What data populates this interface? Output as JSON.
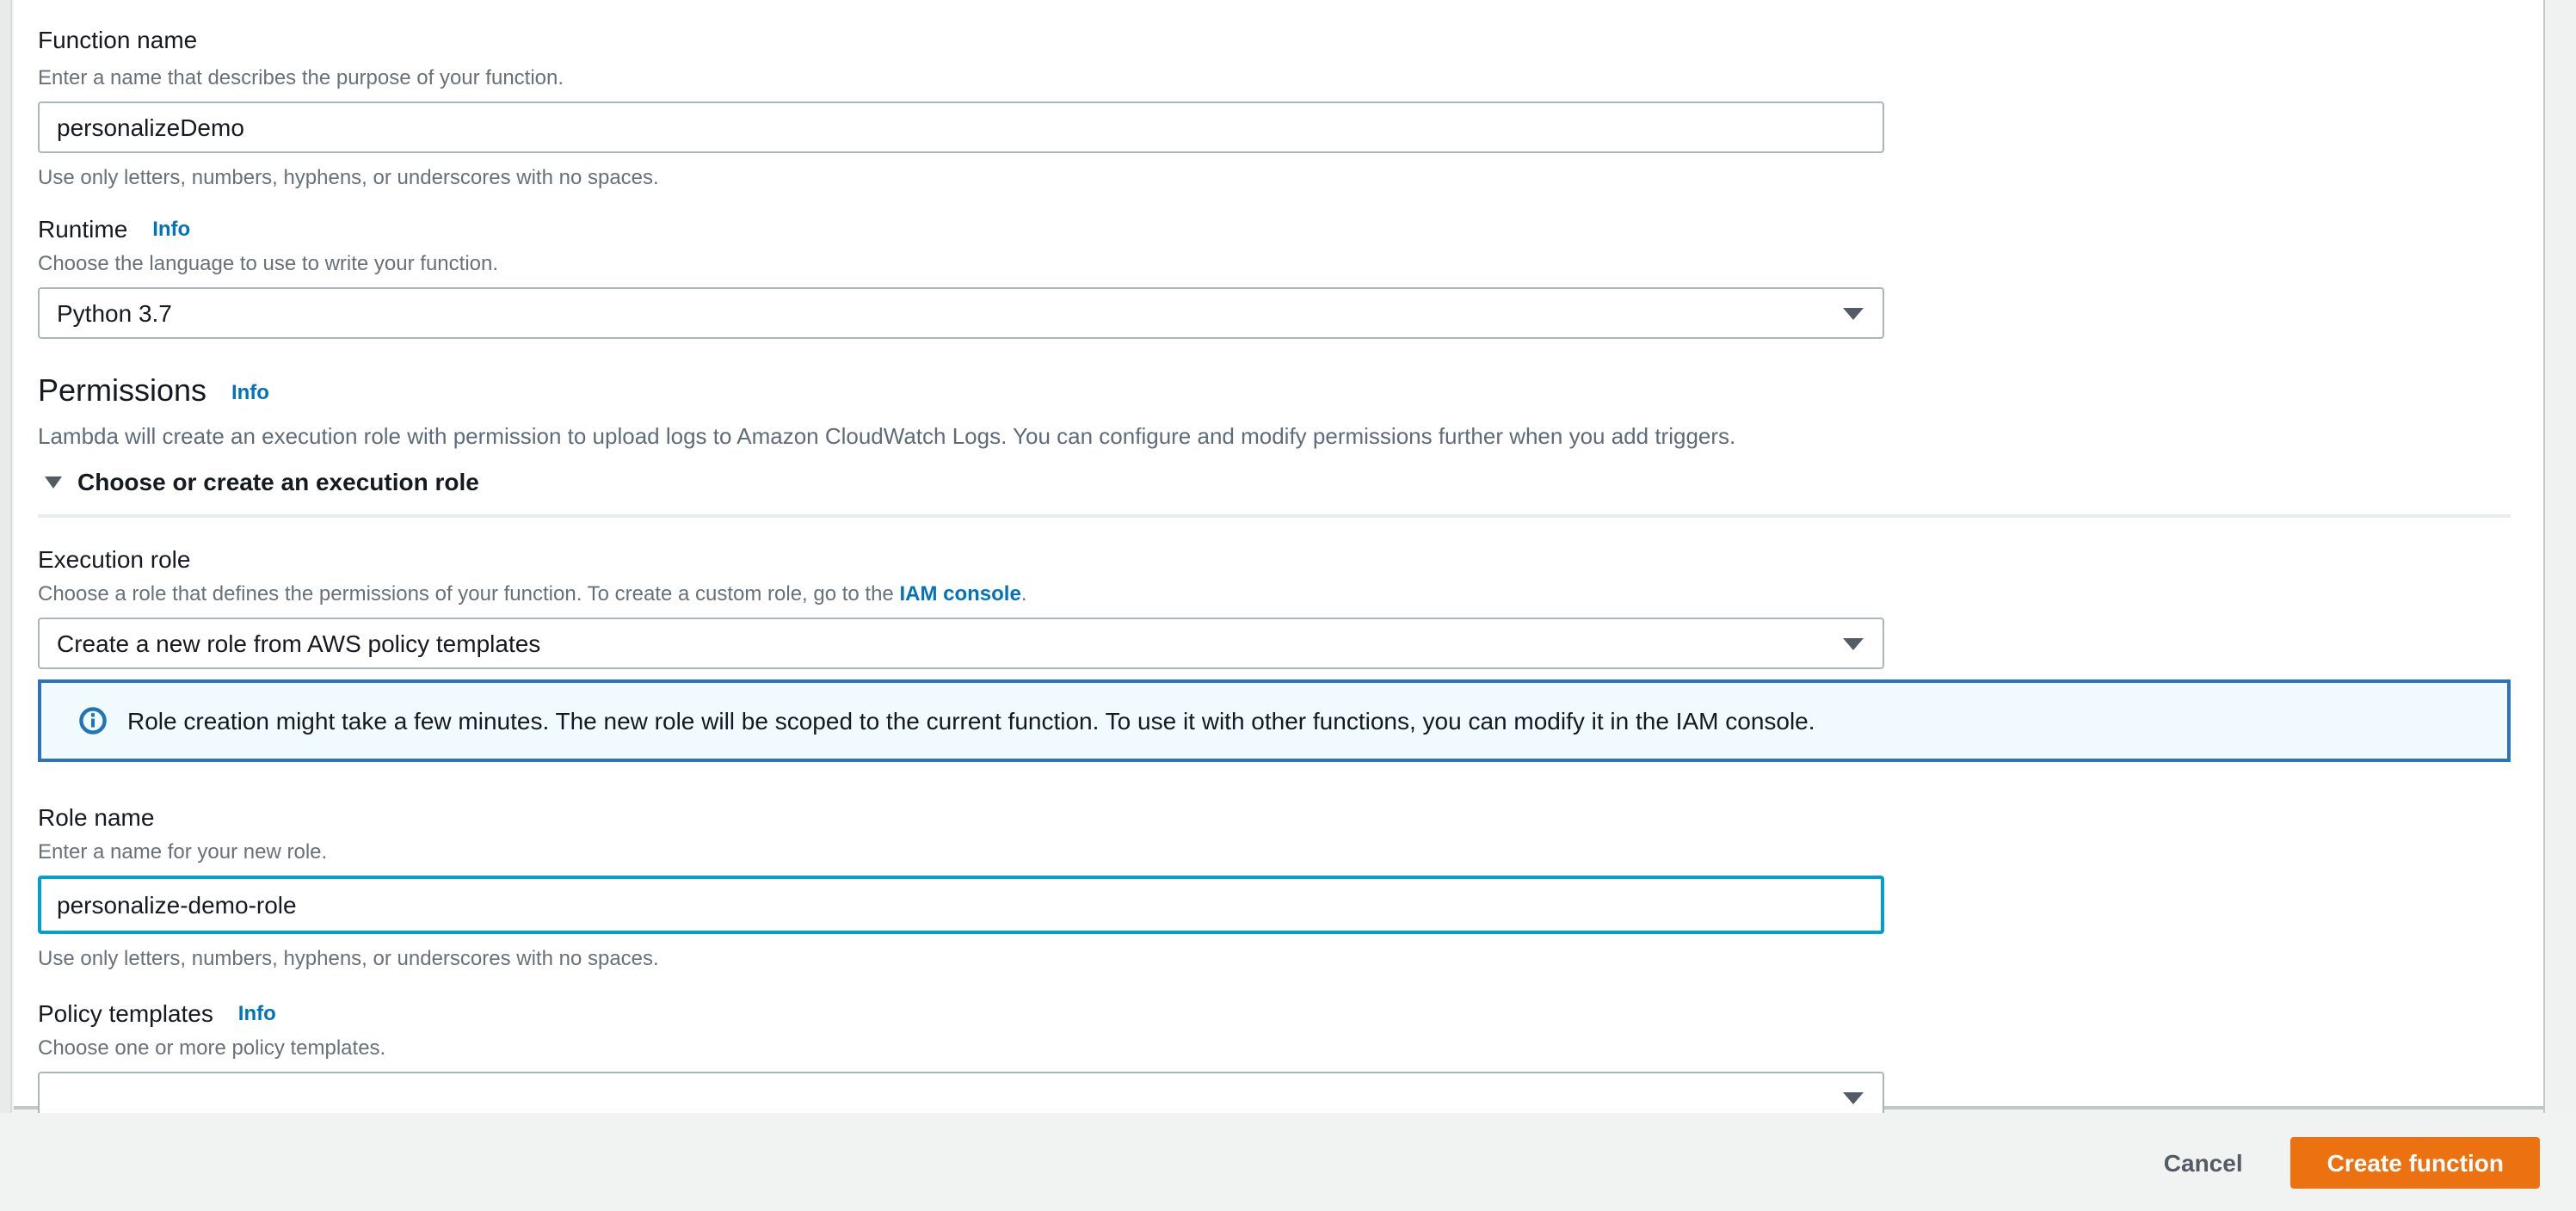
{
  "form": {
    "function_name": {
      "label": "Function name",
      "description": "Enter a name that describes the purpose of your function.",
      "value": "personalizeDemo",
      "helper": "Use only letters, numbers, hyphens, or underscores with no spaces."
    },
    "runtime": {
      "label": "Runtime",
      "info_label": "Info",
      "description": "Choose the language to use to write your function.",
      "value": "Python 3.7"
    },
    "permissions": {
      "title": "Permissions",
      "info_label": "Info",
      "description": "Lambda will create an execution role with permission to upload logs to Amazon CloudWatch Logs. You can configure and modify permissions further when you add triggers.",
      "expander_label": "Choose or create an execution role"
    },
    "execution_role": {
      "label": "Execution role",
      "description_prefix": "Choose a role that defines the permissions of your function. To create a custom role, go to the ",
      "link_label": "IAM console",
      "description_suffix": ".",
      "value": "Create a new role from AWS policy templates"
    },
    "role_alert": {
      "text": "Role creation might take a few minutes. The new role will be scoped to the current function. To use it with other functions, you can modify it in the IAM console."
    },
    "role_name": {
      "label": "Role name",
      "description": "Enter a name for your new role.",
      "value": "personalize-demo-role",
      "helper": "Use only letters, numbers, hyphens, or underscores with no spaces."
    },
    "policy_templates": {
      "label": "Policy templates",
      "info_label": "Info",
      "description": "Choose one or more policy templates.",
      "value": ""
    }
  },
  "footer": {
    "cancel_label": "Cancel",
    "submit_label": "Create function"
  },
  "icons": {
    "dropdown": "caret-down-icon",
    "expander": "caret-down-icon",
    "alert": "info-circle-icon"
  },
  "colors": {
    "accent_orange": "#ec7211",
    "link_blue": "#0073bb",
    "focus_teal": "#00a1c9",
    "alert_bg": "#f1faff",
    "alert_border": "#2e73b8",
    "label_dark": "#16191f",
    "helper_gray": "#687078"
  }
}
